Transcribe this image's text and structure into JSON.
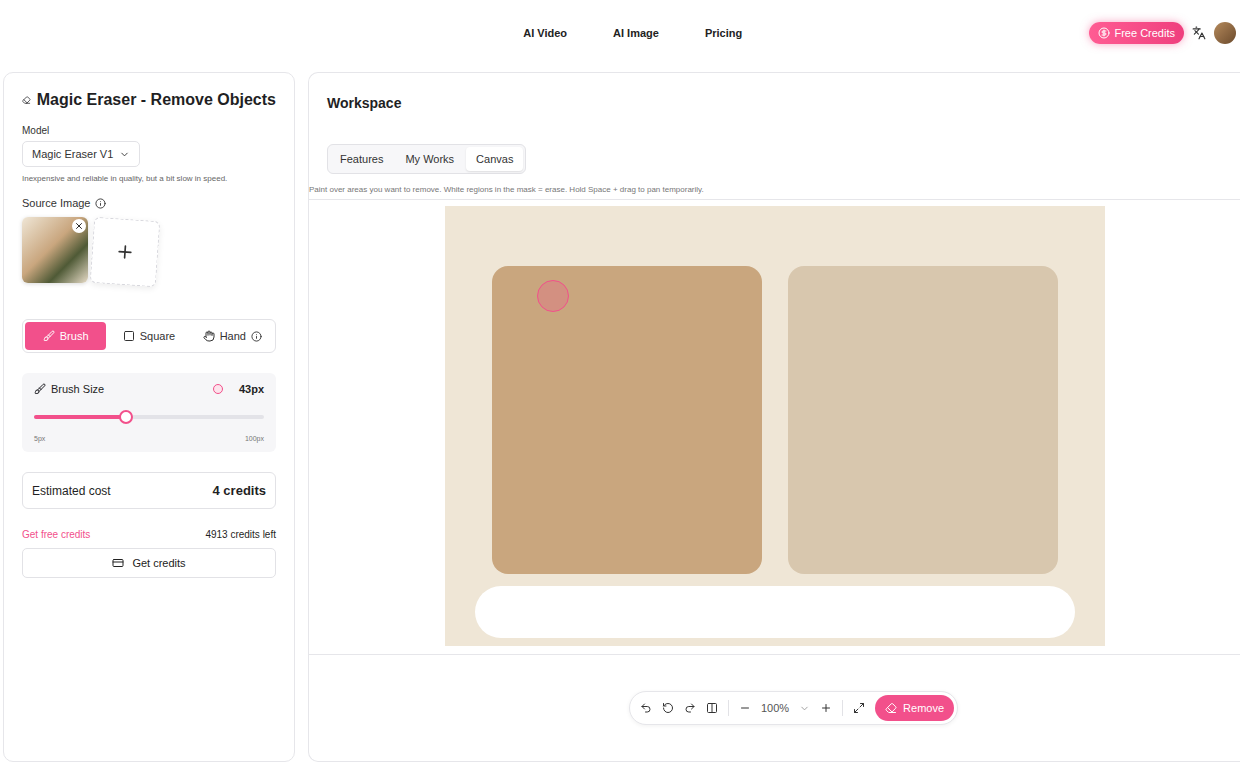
{
  "nav": {
    "items": [
      "AI Video",
      "AI Image",
      "Pricing"
    ],
    "credits_button": "Free Credits"
  },
  "sidebar": {
    "title": "Magic Eraser - Remove Objects",
    "model": {
      "label": "Model",
      "value": "Magic Eraser V1",
      "description": "Inexpensive and reliable in quality, but a bit slow in speed."
    },
    "source_image": {
      "label": "Source Image"
    },
    "tools": [
      {
        "label": "Brush",
        "selected": true
      },
      {
        "label": "Square",
        "selected": false
      },
      {
        "label": "Hand",
        "selected": false
      }
    ],
    "brush_size": {
      "label": "Brush Size",
      "value": "43px",
      "level": 0.4,
      "min": "5px",
      "max": "100px"
    },
    "cost": {
      "label": "Estimated cost",
      "value": "4 credits"
    },
    "free_credits_link": "Get free credits",
    "credits_left": "4913 credits left",
    "get_credits_button": "Get credits"
  },
  "workspace": {
    "title": "Workspace",
    "tabs": [
      {
        "label": "Features",
        "selected": false
      },
      {
        "label": "My Works",
        "selected": false
      },
      {
        "label": "Canvas",
        "selected": true
      }
    ],
    "hint": "Paint over areas you want to remove. White regions in the mask = erase. Hold Space + drag to pan temporarily.",
    "toolbar": {
      "zoom": "100%",
      "remove_button": "Remove"
    }
  }
}
